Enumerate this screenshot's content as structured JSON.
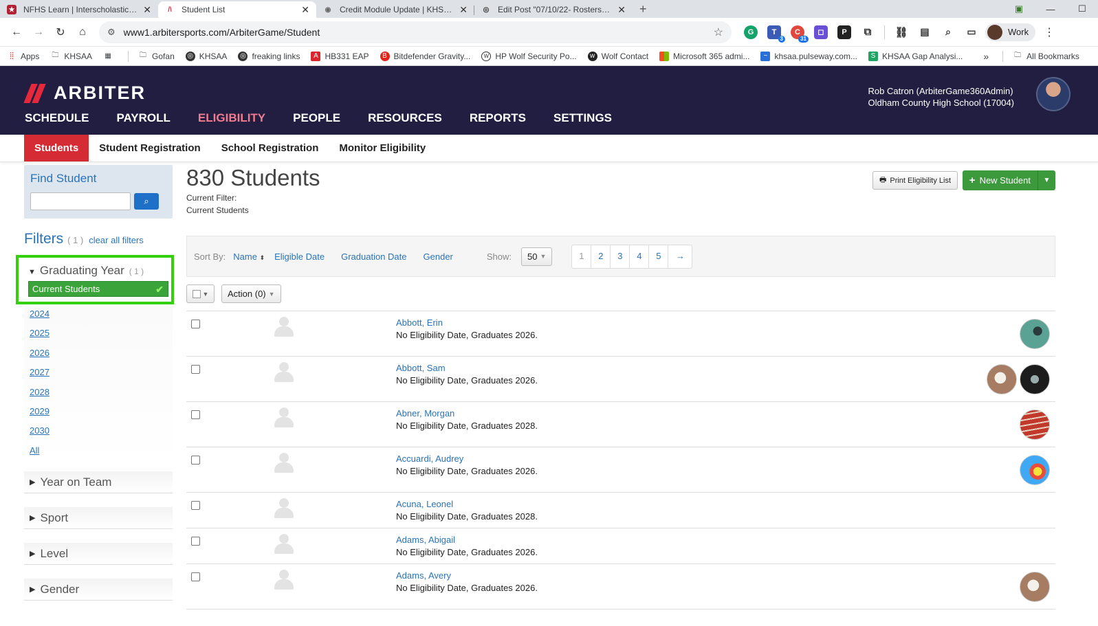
{
  "browser": {
    "tabs": [
      {
        "title": "NFHS Learn | Interscholastic Ed",
        "active": false,
        "fav_color": "#b22234"
      },
      {
        "title": "Student List",
        "active": true,
        "fav_color": "#e5293a"
      },
      {
        "title": "Credit Module Update | KHSAA",
        "active": false,
        "fav_color": "#666666"
      },
      {
        "title": "Edit Post \"07/10/22- Rosters Op",
        "active": false,
        "fav_color": "#333333"
      }
    ],
    "url": "www1.arbitersports.com/ArbiterGame/Student",
    "profile_label": "Work",
    "ext_badges": {
      "a": "3",
      "b": "31"
    },
    "bookmarks": [
      {
        "label": "Apps",
        "icon": "apps-grid-icon"
      },
      {
        "label": "KHSAA",
        "icon": "folder-icon"
      },
      {
        "label": "",
        "icon": "tab-group-icon"
      },
      {
        "label": "Gofan",
        "icon": "folder-icon"
      },
      {
        "label": "KHSAA",
        "icon": "khsaa-icon"
      },
      {
        "label": "freaking links",
        "icon": "khsaa-icon"
      },
      {
        "label": "HB331 EAP",
        "icon": "pdf-icon"
      },
      {
        "label": "Bitdefender Gravity...",
        "icon": "bitdefender-icon"
      },
      {
        "label": "HP Wolf Security Po...",
        "icon": "wolf-icon"
      },
      {
        "label": "Wolf Contact",
        "icon": "wolf-icon"
      },
      {
        "label": "Microsoft 365 admi...",
        "icon": "microsoft-icon"
      },
      {
        "label": "khsaa.pulseway.com...",
        "icon": "pulseway-icon"
      },
      {
        "label": "KHSAA Gap Analysi...",
        "icon": "sheets-icon"
      }
    ],
    "bookmarks_more": "»",
    "all_bookmarks": "All Bookmarks"
  },
  "app": {
    "logo_text": "ARBITER",
    "nav": [
      {
        "label": "SCHEDULE",
        "active": false
      },
      {
        "label": "PAYROLL",
        "active": false
      },
      {
        "label": "ELIGIBILITY",
        "active": true
      },
      {
        "label": "PEOPLE",
        "active": false
      },
      {
        "label": "RESOURCES",
        "active": false
      },
      {
        "label": "REPORTS",
        "active": false
      },
      {
        "label": "SETTINGS",
        "active": false
      }
    ],
    "user": {
      "name": "Rob Catron (ArbiterGame360Admin)",
      "org": "Oldham County High School (17004)"
    },
    "subnav": [
      {
        "label": "Students",
        "active": true
      },
      {
        "label": "Student Registration",
        "active": false
      },
      {
        "label": "School Registration",
        "active": false
      },
      {
        "label": "Monitor Eligibility",
        "active": false
      }
    ]
  },
  "sidebar": {
    "find_title": "Find Student",
    "find_placeholder": "",
    "filters_title": "Filters",
    "filters_count": "( 1 )",
    "clear_all": "clear all filters",
    "graduating_year": {
      "title": "Graduating Year",
      "count": "( 1 )",
      "selected": "Current Students",
      "options": [
        "2024",
        "2025",
        "2026",
        "2027",
        "2028",
        "2029",
        "2030",
        "All"
      ]
    },
    "facets": [
      "Year on Team",
      "Sport",
      "Level",
      "Gender"
    ]
  },
  "main": {
    "count_title": "830 Students",
    "filter_label": "Current Filter:",
    "filter_value": "Current Students",
    "print_button": "Print Eligibility List",
    "new_button": "New Student",
    "sort_label": "Sort By:",
    "sort_options": [
      {
        "label": "Name",
        "active": true
      },
      {
        "label": "Eligible Date",
        "active": false
      },
      {
        "label": "Graduation Date",
        "active": false
      },
      {
        "label": "Gender",
        "active": false
      }
    ],
    "show_label": "Show:",
    "show_value": "50",
    "pages": [
      "1",
      "2",
      "3",
      "4",
      "5"
    ],
    "current_page": "1",
    "next_arrow": "→",
    "action_button": "Action (0)",
    "students": [
      {
        "name": "Abbott, Erin",
        "status": "No Eligibility Date, Graduates 2026.",
        "sports": [
          "lacrosse"
        ]
      },
      {
        "name": "Abbott, Sam",
        "status": "No Eligibility Date, Graduates 2026.",
        "sports": [
          "baseball",
          "lacrosse"
        ]
      },
      {
        "name": "Abner, Morgan",
        "status": "No Eligibility Date, Graduates 2028.",
        "sports": [
          "track"
        ]
      },
      {
        "name": "Accuardi, Audrey",
        "status": "No Eligibility Date, Graduates 2026.",
        "sports": [
          "archery"
        ]
      },
      {
        "name": "Acuna, Leonel",
        "status": "No Eligibility Date, Graduates 2028.",
        "sports": []
      },
      {
        "name": "Adams, Abigail",
        "status": "No Eligibility Date, Graduates 2026.",
        "sports": []
      },
      {
        "name": "Adams, Avery",
        "status": "No Eligibility Date, Graduates 2026.",
        "sports": [
          "baseball"
        ]
      }
    ]
  },
  "colors": {
    "header_bg": "#211e41",
    "nav_active": "#f07c8d",
    "subnav_active": "#d52b34",
    "link": "#2a73b8",
    "success": "#3c9a3c",
    "highlight_border": "#35d00c"
  }
}
